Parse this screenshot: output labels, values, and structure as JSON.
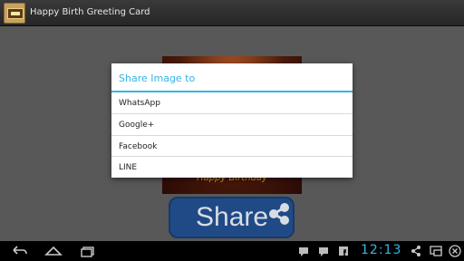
{
  "app": {
    "title": "Happy Birth Greeting Card",
    "icon": "greeting-card-app-icon"
  },
  "content": {
    "card_caption": "Happy Birthday",
    "share_button_label": "Share",
    "share_icon": "share-icon"
  },
  "dialog": {
    "title": "Share Image to",
    "items": [
      {
        "label": "WhatsApp"
      },
      {
        "label": "Google+"
      },
      {
        "label": "Facebook"
      },
      {
        "label": "LINE"
      }
    ]
  },
  "status_bar": {
    "time": "12:13",
    "icons": [
      "chat-notification-icon",
      "chat-notification-icon",
      "facebook-icon",
      "share-icon",
      "screen-mirror-icon",
      "close-notification-icon"
    ]
  },
  "nav_bar": {
    "buttons": [
      "back-icon",
      "home-icon",
      "recent-apps-icon"
    ]
  },
  "colors": {
    "accent": "#33b5e5",
    "share_button": "#1f4a86"
  }
}
